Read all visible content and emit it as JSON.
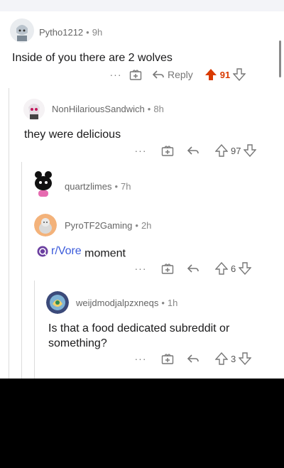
{
  "comments": [
    {
      "author": "Pytho1212",
      "sep": "•",
      "age": "9h",
      "body": "Inside of you there are 2 wolves",
      "more": "···",
      "reply_label": "Reply",
      "score": "91",
      "upvoted": true,
      "upvote_color": "#d93a00"
    },
    {
      "author": "NonHilariousSandwich",
      "sep": "•",
      "age": "8h",
      "body": "they were delicious",
      "more": "···",
      "score": "97"
    },
    {
      "author": "quartzlimes",
      "sep": "•",
      "age": "7h"
    },
    {
      "author": "PyroTF2Gaming",
      "sep": "•",
      "age": "2h",
      "subreddit_link": "r/Vore",
      "body_rest": " moment",
      "more": "···",
      "score": "6"
    },
    {
      "author": "weijdmodjalpzxneqs",
      "sep": "•",
      "age": "1h",
      "body_line1": "Is that a food dedicated subreddit or",
      "body_line2": "something?",
      "more": "···",
      "score": "3"
    }
  ],
  "colors": {
    "accent": "#d93a00",
    "link": "#3b5bdb",
    "thread_line": "#dcdcdc"
  },
  "icons": [
    "award-icon",
    "reply-arrow-icon",
    "upvote-icon",
    "downvote-icon",
    "more-icon"
  ]
}
